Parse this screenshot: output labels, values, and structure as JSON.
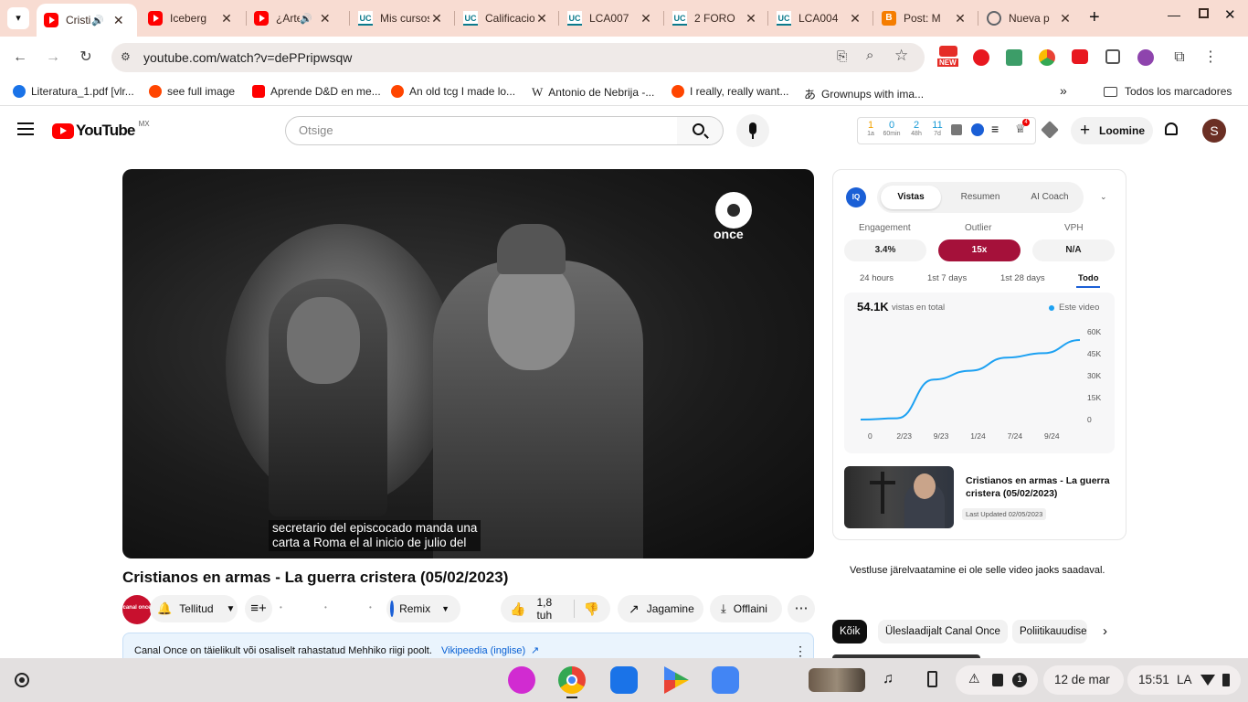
{
  "browser": {
    "tabs": [
      {
        "title": "Cristianos en armas",
        "icon": "youtube-icon",
        "active": true,
        "audio": true
      },
      {
        "title": "Iceberg",
        "icon": "youtube-icon"
      },
      {
        "title": "¿Arte",
        "icon": "youtube-icon",
        "audio": true
      },
      {
        "title": "Mis cursos",
        "icon": "uc-icon"
      },
      {
        "title": "Calificaciones",
        "icon": "uc-icon"
      },
      {
        "title": "LCA007",
        "icon": "uc-icon"
      },
      {
        "title": "2 FORO",
        "icon": "uc-icon"
      },
      {
        "title": "LCA004",
        "icon": "uc-icon"
      },
      {
        "title": "Post: M",
        "icon": "blogger-icon"
      },
      {
        "title": "Nueva p",
        "icon": "globe-icon"
      }
    ],
    "url": "youtube.com/watch?v=dePPripwsqw",
    "new_badge": "NEW",
    "bookmarks": [
      {
        "label": "Literatura_1.pdf [vlr...",
        "color": "#1a73e8"
      },
      {
        "label": "see full image",
        "color": "#ff4500"
      },
      {
        "label": "Aprende D&D en me...",
        "color": "#ff0000"
      },
      {
        "label": "An old tcg I made lo...",
        "color": "#ff4500"
      },
      {
        "label": "Antonio de Nebrija -...",
        "color": "#202124"
      },
      {
        "label": "I really, really want...",
        "color": "#ff4500"
      },
      {
        "label": "Grownups with ima...",
        "color": "#202124"
      }
    ],
    "all_bookmarks": "Todos los marcadores"
  },
  "youtube": {
    "logo": "YouTube",
    "region": "MX",
    "search_placeholder": "Otsige",
    "stats_mini": [
      {
        "value": "1",
        "label": "1a",
        "color": "#f2a100"
      },
      {
        "value": "0",
        "label": "60min",
        "color": "#1a9ad6"
      },
      {
        "value": "2",
        "label": "48h",
        "color": "#1a9ad6"
      },
      {
        "value": "11",
        "label": "7d",
        "color": "#1a9ad6"
      }
    ],
    "create_label": "Loomine",
    "avatar_letter": "S",
    "notif_count": "4",
    "channel_watermark": "once",
    "caption_line1": "secretario del episcocado manda una",
    "caption_line2": "carta a Roma el al inicio de julio del",
    "video_title": "Cristianos en armas - La guerra cristera (05/02/2023)",
    "channel_logo": "canal once",
    "subscribed_label": "Tellitud",
    "remix_label": "Remix",
    "likes": "1,8 tuh",
    "share_label": "Jagamine",
    "download_label": "Offlaini",
    "description": "Canal Once on täielikult või osaliselt rahastatud Mehhiko riigi poolt.",
    "wiki_link": "Vikipeedia (inglise)",
    "chat_unavailable": "Vestluse järelvaatamine ei ole selle video jaoks saadaval.",
    "chips": [
      "Kõik",
      "Üleslaadijalt Canal Once",
      "Poliitikauudised"
    ]
  },
  "iq_panel": {
    "logo": "IQ",
    "tabs": [
      "Vistas",
      "Resumen",
      "AI Coach"
    ],
    "active_tab": "Vistas",
    "stats": [
      {
        "label": "Engagement",
        "value": "3.4%"
      },
      {
        "label": "Outlier",
        "value": "15x"
      },
      {
        "label": "VPH",
        "value": "N/A"
      }
    ],
    "ranges": [
      "24 hours",
      "1st 7 days",
      "1st 28 days",
      "Todo"
    ],
    "active_range": "Todo",
    "total_views": "54.1K",
    "total_label": "vistas en total",
    "legend": "Este video",
    "accent": "#1da1f2",
    "outlier_color": "#a5113a",
    "video_title": "Cristianos en armas - La guerra cristera (05/02/2023)",
    "updated": "Last Updated 02/05/2023"
  },
  "chart_data": {
    "type": "line",
    "x": [
      "0",
      "2/23",
      "9/23",
      "1/24",
      "7/24",
      "9/24"
    ],
    "series": [
      {
        "values": [
          600,
          1500,
          28000,
          34000,
          43000,
          46000,
          55000
        ]
      }
    ],
    "xticks": [
      "0",
      "2/23",
      "9/23",
      "1/24",
      "7/24",
      "9/24"
    ],
    "yticks": [
      "60K",
      "45K",
      "30K",
      "15K",
      "0"
    ],
    "ylim": [
      0,
      60000
    ],
    "legend": "Este video",
    "color": "#1da1f2"
  },
  "shelf": {
    "date": "12 de mar",
    "time": "15:51",
    "locale": "LA",
    "notif": "1"
  }
}
